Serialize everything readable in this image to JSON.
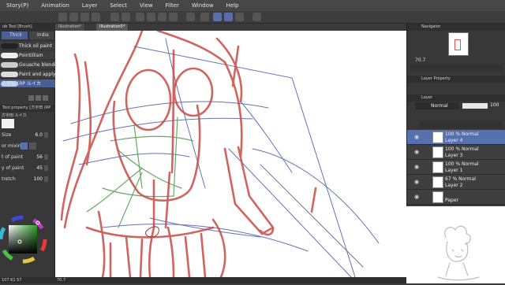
{
  "menu": [
    "Story(P)",
    "Animation",
    "Layer",
    "Select",
    "View",
    "Filter",
    "Window",
    "Help"
  ],
  "tabs": [
    {
      "label": "Illustration*",
      "active": false
    },
    {
      "label": "Illustration5*",
      "active": true
    }
  ],
  "left": {
    "subtool_header": "ub Tool [Brush]",
    "group_tabs": [
      "Thick",
      "India"
    ],
    "brushes": [
      {
        "label": "Thick oil paint",
        "selected": false
      },
      {
        "label": "Pointillism",
        "selected": false
      },
      {
        "label": "Gouache blender",
        "selected": false
      },
      {
        "label": "Paint and apply",
        "selected": false
      },
      {
        "label": "方宇田 (RP ルイカ",
        "selected": true
      }
    ],
    "tool_property_header": "Tool property [方宇田 (RP",
    "tool_property_sub": "方宇田 ルイカ",
    "properties": [
      {
        "label": "Size",
        "value": "6.0"
      },
      {
        "label": "or mixing",
        "value": ""
      },
      {
        "label": "t of paint",
        "value": "56"
      },
      {
        "label": "y of paint",
        "value": "45"
      },
      {
        "label": "tretch",
        "value": "100"
      }
    ],
    "color_readout": "107 61 57",
    "color_hex": "#3f6e3b"
  },
  "right": {
    "navigator_header": "Navigator",
    "nav_zoom": "70.7",
    "layer_property_header": "Layer Property",
    "layer_header": "Layer",
    "blend_mode": "Normal",
    "opacity": "100",
    "layers": [
      {
        "line1": "100 % Normal",
        "line2": "Layer 4",
        "selected": true
      },
      {
        "line1": "100 % Normal",
        "line2": "Layer 3",
        "selected": false
      },
      {
        "line1": "100 % Normal",
        "line2": "Layer 1",
        "selected": false
      },
      {
        "line1": "67 % Normal",
        "line2": "Layer 2",
        "selected": false
      },
      {
        "line1": "",
        "line2": "Paper",
        "selected": false
      }
    ]
  },
  "status": {
    "zoom": "70.7"
  },
  "colors": {
    "accent": "#5671b0",
    "sketch_red": "#c84a44",
    "sketch_blue": "#3d4fa8",
    "sketch_green": "#4e9a4a"
  },
  "icons": [
    "brush-icon",
    "eye-icon",
    "pen-icon",
    "undo-icon",
    "redo-icon",
    "lasso-icon",
    "save-icon"
  ]
}
